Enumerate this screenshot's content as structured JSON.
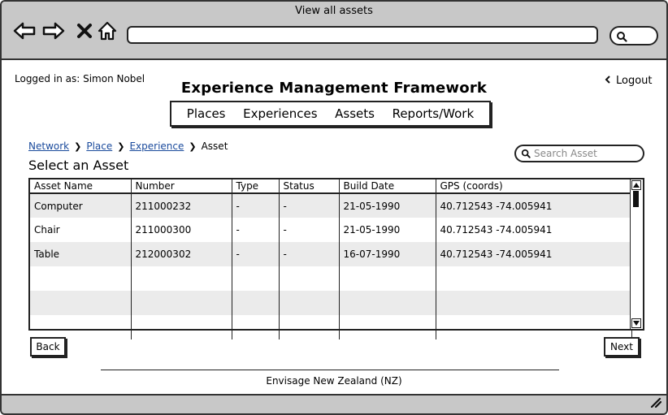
{
  "window": {
    "title": "View all assets"
  },
  "browser": {
    "back_icon": "arrow-left-icon",
    "forward_icon": "arrow-right-icon",
    "stop_icon": "close-icon",
    "home_icon": "home-icon",
    "url": ""
  },
  "header": {
    "logged_in": "Logged in as: Simon Nobel",
    "app_title": "Experience Management Framework",
    "logout_label": "Logout"
  },
  "nav": {
    "items": [
      "Places",
      "Experiences",
      "Assets",
      "Reports/Work"
    ]
  },
  "breadcrumb": {
    "items": [
      "Network",
      "Place",
      "Experience",
      "Asset"
    ]
  },
  "section_title": "Select an Asset",
  "search": {
    "placeholder": "Search Asset"
  },
  "table": {
    "columns": [
      "Asset Name",
      "Number",
      "Type",
      "Status",
      "Build Date",
      "GPS (coords)"
    ],
    "rows": [
      [
        "Computer",
        "211000232",
        "-",
        "-",
        "21-05-1990",
        "40.712543 -74.005941"
      ],
      [
        "Chair",
        "211000300",
        "-",
        "-",
        "21-05-1990",
        "40.712543 -74.005941"
      ],
      [
        "Table",
        "212000302",
        "-",
        "-",
        "16-07-1990",
        "40.712543 -74.005941"
      ],
      [
        "",
        "",
        "",
        "",
        "",
        ""
      ],
      [
        "",
        "",
        "",
        "",
        "",
        ""
      ],
      [
        "",
        "",
        "",
        "",
        "",
        ""
      ]
    ]
  },
  "buttons": {
    "back": "Back",
    "next": "Next"
  },
  "footer": {
    "text": "Envisage New Zealand (NZ)"
  },
  "colors": {
    "chrome": "#c8c8c8",
    "link": "#1a4a9c",
    "row_alt": "#ebebeb"
  }
}
